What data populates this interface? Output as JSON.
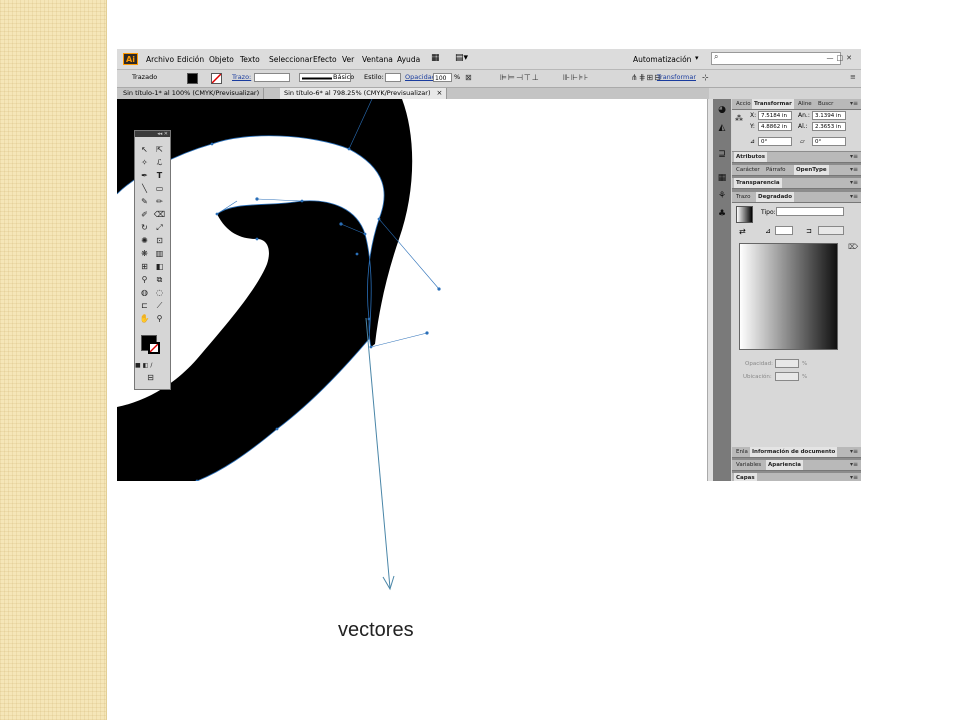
{
  "app": {
    "logo": "Ai"
  },
  "menu": [
    "Archivo",
    "Edición",
    "Objeto",
    "Texto",
    "Seleccionar",
    "Efecto",
    "Ver",
    "Ventana",
    "Ayuda"
  ],
  "workspace": {
    "label": "Automatización",
    "arrow": "▾"
  },
  "control_bar": {
    "selection_label": "Trazado",
    "stroke_label": "Trazo:",
    "brush_label": "Básico",
    "style_label": "Estilo:",
    "opacity_label": "Opacidad:",
    "opacity_value": "100",
    "opacity_unit": "%",
    "transform_link": "Transformar"
  },
  "tabs": [
    {
      "label": "Sin título-1* al 100% (CMYK/Previsualizar)",
      "active": false
    },
    {
      "label": "Sin título-6* al 798.25% (CMYK/Previsualizar)",
      "active": true,
      "close": "×"
    }
  ],
  "panels": {
    "row1_tabs": [
      "Accio",
      "Transformar",
      "Aline",
      "Buscr"
    ],
    "transform": {
      "x_label": "X:",
      "x_value": "7.5184 in",
      "y_label": "Y:",
      "y_value": "4.8862 in",
      "w_label": "An.:",
      "w_value": "3.1394 in",
      "h_label": "Al.:",
      "h_value": "2.3653 in",
      "rotate_value": "0°",
      "shear_value": "0°"
    },
    "attributes_tab": "Atributos",
    "char_tabs": [
      "Carácter",
      "Párrafo",
      "OpenType"
    ],
    "transparency_tab": "Transparencia",
    "gradient_tabs": [
      "Trazo",
      "Degradado"
    ],
    "gradient": {
      "type_label": "Tipo:",
      "opacity_label": "Opacidad:",
      "location_label": "Ubicación:",
      "unit": "%"
    },
    "doc_tabs": [
      "Enla",
      "Información de documento"
    ],
    "var_tabs": [
      "Variables",
      "Apariencia"
    ],
    "layers_tab": "Capas"
  },
  "annotation": {
    "caption": "vectores"
  },
  "colors": {
    "side_strip": "#f5e6b8",
    "ui_gray": "#d4d4d4",
    "vector_blue": "#2a6fb8",
    "arrow": "#4a86a8"
  }
}
